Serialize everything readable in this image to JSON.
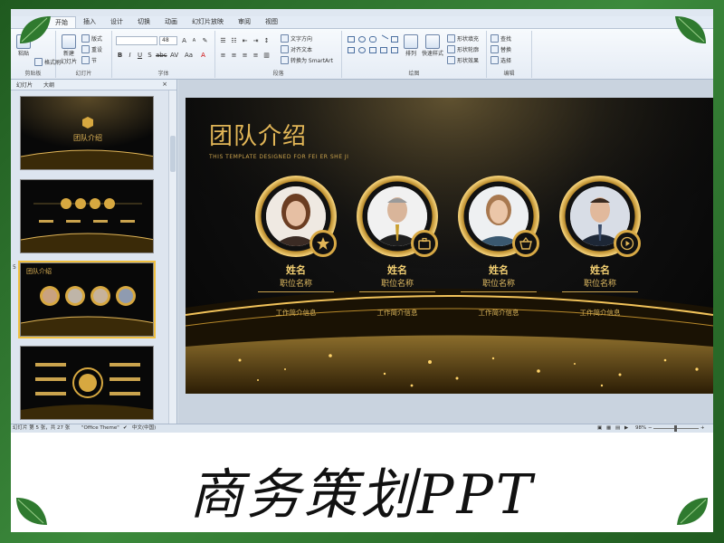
{
  "window": {
    "title": ""
  },
  "ribbon": {
    "tabs": [
      {
        "label": "开始",
        "active": true
      },
      {
        "label": "插入",
        "active": false
      },
      {
        "label": "设计",
        "active": false
      },
      {
        "label": "切换",
        "active": false
      },
      {
        "label": "动画",
        "active": false
      },
      {
        "label": "幻灯片放映",
        "active": false
      },
      {
        "label": "审阅",
        "active": false
      },
      {
        "label": "视图",
        "active": false
      }
    ],
    "clipboard": {
      "paste_label": "粘贴",
      "format_painter": "格式刷",
      "group_label": "剪贴板"
    },
    "slides": {
      "new_slide": "新建\n幻灯片",
      "layout": "版式",
      "reset": "重设",
      "section": "节",
      "group_label": "幻灯片"
    },
    "font": {
      "font_size": "48",
      "group_label": "字体"
    },
    "paragraph": {
      "text_direction": "文字方向",
      "align_text": "对齐文本",
      "smartart": "转换为 SmartArt",
      "group_label": "段落"
    },
    "drawing": {
      "arrange": "排列",
      "quick_styles": "快速样式",
      "fill": "形状填充",
      "outline": "形状轮廓",
      "effects": "形状效果",
      "group_label": "绘图"
    },
    "editing": {
      "find": "查找",
      "replace": "替换",
      "select": "选择",
      "group_label": "编辑"
    }
  },
  "left_panel": {
    "tabs": [
      "幻灯片",
      "大纲"
    ],
    "close_icon": "×",
    "thumbs": [
      {
        "num": "",
        "title": "团队介绍"
      },
      {
        "num": "",
        "title": ""
      },
      {
        "num": "5",
        "title": "团队介绍"
      },
      {
        "num": "",
        "title": ""
      }
    ]
  },
  "slide": {
    "title": "团队介绍",
    "subtitle": "THIS TEMPLATE DESIGNED FOR FEI ER SHE JI",
    "members": [
      {
        "name": "姓名",
        "role": "职位名称",
        "info": "工作简介信息",
        "badge_icon": "star-icon",
        "photo": "woman-1"
      },
      {
        "name": "姓名",
        "role": "职位名称",
        "info": "工作简介信息",
        "badge_icon": "briefcase-icon",
        "photo": "man-1"
      },
      {
        "name": "姓名",
        "role": "职位名称",
        "info": "工作简介信息",
        "badge_icon": "basket-icon",
        "photo": "woman-2"
      },
      {
        "name": "姓名",
        "role": "职位名称",
        "info": "工作简介信息",
        "badge_icon": "play-icon",
        "photo": "man-2"
      }
    ],
    "colors": {
      "gold": "#e2b657",
      "background": "#050505"
    }
  },
  "status": {
    "slide_info": "幻灯片 第 5 张，共 27 张",
    "theme": "\"Office Theme\"",
    "language": "中文(中国)",
    "zoom": "98%"
  },
  "caption": "商务策划PPT"
}
